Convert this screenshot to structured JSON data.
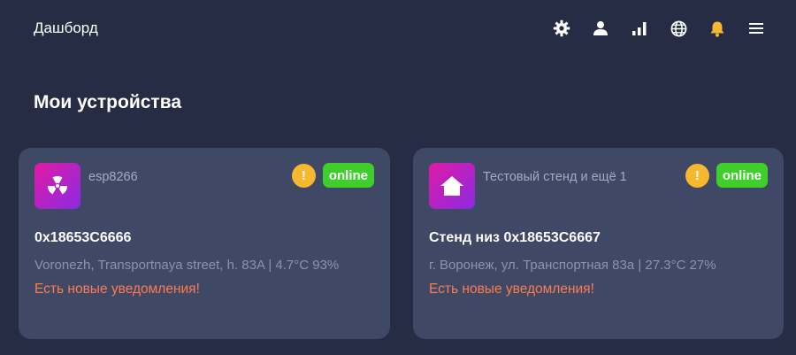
{
  "header": {
    "title": "Дашборд",
    "icons": [
      "gear-icon",
      "user-icon",
      "bar-chart-icon",
      "globe-icon",
      "bell-icon",
      "menu-icon"
    ],
    "accent_bell": "#f5b82e"
  },
  "page": {
    "title": "Мои устройства"
  },
  "devices": [
    {
      "icon": "radiation-icon",
      "name": "esp8266",
      "warning_symbol": "!",
      "status": "online",
      "id_line": "0x18653C6666",
      "info": "Voronezh, Transportnaya street, h. 83A | 4.7°C 93%",
      "alert": "Есть новые уведомления!"
    },
    {
      "icon": "home-icon",
      "name": "Тестовый стенд и ещё 1",
      "warning_symbol": "!",
      "status": "online",
      "id_line": "Стенд низ 0x18653C6667",
      "info": "г. Воронеж, ул. Транспортная 83а | 27.3°C 27%",
      "alert": "Есть новые уведомления!"
    }
  ],
  "colors": {
    "background": "#262c44",
    "card": "#3f4865",
    "status_online": "#3ecf2a",
    "warning": "#f5b82e",
    "alert_text": "#ff7b4f"
  }
}
